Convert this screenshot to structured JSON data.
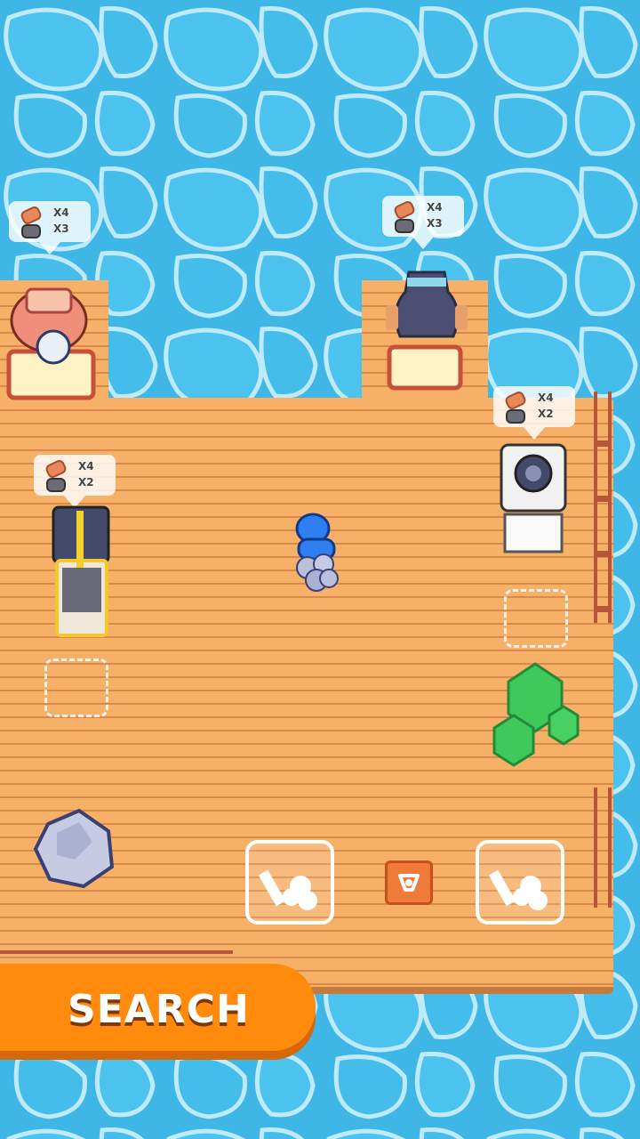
{
  "hud": {
    "search_label": "SEARCH"
  },
  "stations": [
    {
      "name": "sawmill-top-left",
      "log_count": "X4",
      "rock_count": "X3"
    },
    {
      "name": "furnace-top-center",
      "log_count": "X4",
      "rock_count": "X3"
    },
    {
      "name": "press-right",
      "log_count": "X4",
      "rock_count": "X2"
    },
    {
      "name": "crusher-left",
      "log_count": "X4",
      "rock_count": "X2"
    }
  ],
  "colors": {
    "water": "#3fb7e6",
    "deck": "#f7b068",
    "search_button": "#ff8a0c",
    "player": "#2f7ff0",
    "tree": "#3fc95a"
  },
  "icons": [
    "log-icon",
    "rock-icon",
    "recycle-icon",
    "resource-card-icon"
  ]
}
